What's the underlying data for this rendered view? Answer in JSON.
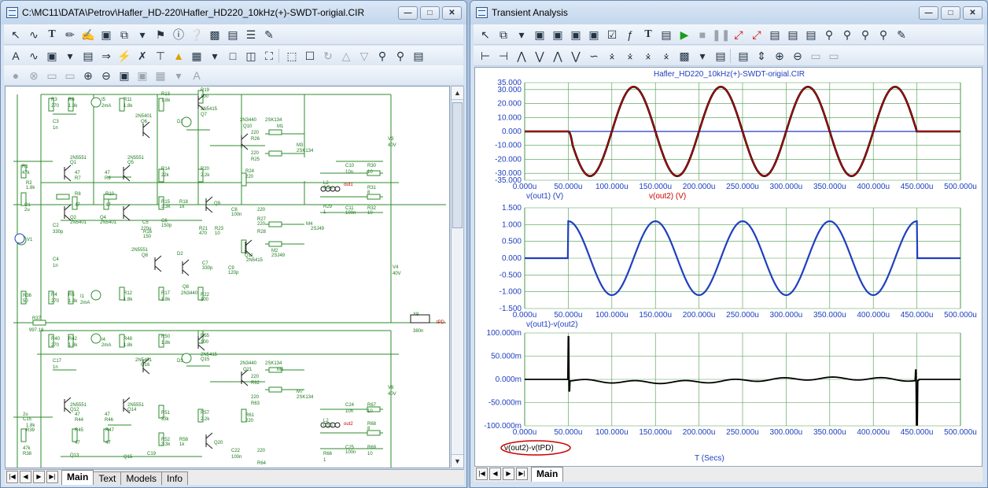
{
  "left_window": {
    "title": "C:\\MC11\\DATA\\Petrov\\Hafler_HD-220\\Hafler_HD220_10kHz(+)-SWDT-origial.CIR",
    "window_buttons": [
      "min-icon",
      "max-icon",
      "close-icon"
    ],
    "tabs": [
      "Main",
      "Text",
      "Models",
      "Info"
    ],
    "active_tab": "Main",
    "schematic_labels": [
      {
        "t": "R3",
        "c": "g"
      },
      {
        "t": "270",
        "c": "g"
      },
      {
        "t": "R6",
        "c": "g"
      },
      {
        "t": "1.8k",
        "c": "g"
      },
      {
        "t": "I5",
        "c": "g"
      },
      {
        "t": "2mA",
        "c": "g"
      },
      {
        "t": "R11",
        "c": "g"
      },
      {
        "t": "1.8k",
        "c": "g"
      },
      {
        "t": "R13",
        "c": "g"
      },
      {
        "t": "1.8k",
        "c": "g"
      },
      {
        "t": "R19",
        "c": "g"
      },
      {
        "t": "100",
        "c": "g"
      },
      {
        "t": "2N5415",
        "c": "g"
      },
      {
        "t": "Q7",
        "c": "g"
      },
      {
        "t": "C3",
        "c": "g"
      },
      {
        "t": "1n",
        "c": "g"
      },
      {
        "t": "2N5401",
        "c": "g"
      },
      {
        "t": "Q6",
        "c": "g"
      },
      {
        "t": "D1",
        "c": "g"
      },
      {
        "t": "2N3440",
        "c": "g"
      },
      {
        "t": "2SK134",
        "c": "g"
      },
      {
        "t": "Q10",
        "c": "g"
      },
      {
        "t": "M1",
        "c": "g"
      },
      {
        "t": "220",
        "c": "g"
      },
      {
        "t": "R26",
        "c": "g"
      },
      {
        "t": "M3",
        "c": "g"
      },
      {
        "t": "2SK134",
        "c": "g"
      },
      {
        "t": "220",
        "c": "g"
      },
      {
        "t": "R25",
        "c": "g"
      },
      {
        "t": "V3",
        "c": "g"
      },
      {
        "t": "40V",
        "c": "g"
      },
      {
        "t": "R1",
        "c": "g"
      },
      {
        "t": "47k",
        "c": "g"
      },
      {
        "t": "2N5551",
        "c": "g"
      },
      {
        "t": "Q1",
        "c": "g"
      },
      {
        "t": "2N5551",
        "c": "g"
      },
      {
        "t": "Q5",
        "c": "g"
      },
      {
        "t": "47",
        "c": "g"
      },
      {
        "t": "R7",
        "c": "g"
      },
      {
        "t": "47",
        "c": "g"
      },
      {
        "t": "R9",
        "c": "g"
      },
      {
        "t": "R14",
        "c": "g"
      },
      {
        "t": "22k",
        "c": "g"
      },
      {
        "t": "R20",
        "c": "g"
      },
      {
        "t": "2.2k",
        "c": "g"
      },
      {
        "t": "R24",
        "c": "g"
      },
      {
        "t": "220",
        "c": "g"
      },
      {
        "t": "C10",
        "c": "g"
      },
      {
        "t": "10n",
        "c": "g"
      },
      {
        "t": "R30",
        "c": "g"
      },
      {
        "t": "10",
        "c": "g"
      },
      {
        "t": "R2",
        "c": "g"
      },
      {
        "t": "1.8k",
        "c": "g"
      },
      {
        "t": "C1",
        "c": "g"
      },
      {
        "t": "2u",
        "c": "g"
      },
      {
        "t": "R8",
        "c": "g"
      },
      {
        "t": "47",
        "c": "g"
      },
      {
        "t": "R10",
        "c": "g"
      },
      {
        "t": "47",
        "c": "g"
      },
      {
        "t": "R15",
        "c": "g"
      },
      {
        "t": "3.3k",
        "c": "g"
      },
      {
        "t": "R18",
        "c": "g"
      },
      {
        "t": "1k",
        "c": "g"
      },
      {
        "t": "Q9",
        "c": "g"
      },
      {
        "t": "C8",
        "c": "g"
      },
      {
        "t": "100n",
        "c": "g"
      },
      {
        "t": "L2",
        "c": "g"
      },
      {
        "t": "0.5u",
        "c": "g"
      },
      {
        "t": "out1",
        "c": "r"
      },
      {
        "t": "R31",
        "c": "g"
      },
      {
        "t": "8",
        "c": "g"
      },
      {
        "t": "R29",
        "c": "g"
      },
      {
        "t": "1",
        "c": "g"
      },
      {
        "t": "C11",
        "c": "g"
      },
      {
        "t": "100n",
        "c": "g"
      },
      {
        "t": "R32",
        "c": "g"
      },
      {
        "t": "10",
        "c": "g"
      },
      {
        "t": "Q2",
        "c": "g"
      },
      {
        "t": "2N5401",
        "c": "g"
      },
      {
        "t": "Q4",
        "c": "g"
      },
      {
        "t": "2N5401",
        "c": "g"
      },
      {
        "t": "C5",
        "c": "g"
      },
      {
        "t": "220u",
        "c": "g"
      },
      {
        "t": "C6",
        "c": "g"
      },
      {
        "t": "150p",
        "c": "g"
      },
      {
        "t": "R16",
        "c": "g"
      },
      {
        "t": "150",
        "c": "g"
      },
      {
        "t": "R21",
        "c": "g"
      },
      {
        "t": "470",
        "c": "g"
      },
      {
        "t": "R23",
        "c": "g"
      },
      {
        "t": "10",
        "c": "g"
      },
      {
        "t": "220",
        "c": "g"
      },
      {
        "t": "R27",
        "c": "g"
      },
      {
        "t": "220",
        "c": "g"
      },
      {
        "t": "R28",
        "c": "g"
      },
      {
        "t": "M4",
        "c": "g"
      },
      {
        "t": "2SJ49",
        "c": "g"
      },
      {
        "t": "C2",
        "c": "g"
      },
      {
        "t": "330p",
        "c": "g"
      },
      {
        "t": "V1",
        "c": "g"
      },
      {
        "t": "2N5551",
        "c": "g"
      },
      {
        "t": "Q8",
        "c": "g"
      },
      {
        "t": "D2",
        "c": "g"
      },
      {
        "t": "Q11",
        "c": "g"
      },
      {
        "t": "2N5415",
        "c": "g"
      },
      {
        "t": "M2",
        "c": "g"
      },
      {
        "t": "2SJ49",
        "c": "g"
      },
      {
        "t": "C4",
        "c": "g"
      },
      {
        "t": "1n",
        "c": "g"
      },
      {
        "t": "C7",
        "c": "g"
      },
      {
        "t": "330p",
        "c": "g"
      },
      {
        "t": "C9",
        "c": "g"
      },
      {
        "t": "120p",
        "c": "g"
      },
      {
        "t": "Q8",
        "c": "g"
      },
      {
        "t": "2N3440",
        "c": "g"
      },
      {
        "t": "V4",
        "c": "g"
      },
      {
        "t": "40V",
        "c": "g"
      },
      {
        "t": "R36",
        "c": "g"
      },
      {
        "t": "50",
        "c": "g"
      },
      {
        "t": "R4",
        "c": "g"
      },
      {
        "t": "270",
        "c": "g"
      },
      {
        "t": "R5",
        "c": "g"
      },
      {
        "t": "1.8k",
        "c": "g"
      },
      {
        "t": "I1",
        "c": "g"
      },
      {
        "t": "2mA",
        "c": "g"
      },
      {
        "t": "R12",
        "c": "g"
      },
      {
        "t": "1.8k",
        "c": "g"
      },
      {
        "t": "R17",
        "c": "g"
      },
      {
        "t": "1.8k",
        "c": "g"
      },
      {
        "t": "R22",
        "c": "g"
      },
      {
        "t": "100",
        "c": "g"
      },
      {
        "t": "R37",
        "c": "g"
      },
      {
        "t": "997.18",
        "c": "g"
      },
      {
        "t": "X9",
        "c": "g"
      },
      {
        "t": "380n",
        "c": "g"
      },
      {
        "t": "tPD",
        "c": "r"
      },
      {
        "t": "R40",
        "c": "g"
      },
      {
        "t": "270",
        "c": "g"
      },
      {
        "t": "R42",
        "c": "g"
      },
      {
        "t": "1.8k",
        "c": "g"
      },
      {
        "t": "I4",
        "c": "g"
      },
      {
        "t": "2mA",
        "c": "g"
      },
      {
        "t": "R48",
        "c": "g"
      },
      {
        "t": "1.8k",
        "c": "g"
      },
      {
        "t": "R50",
        "c": "g"
      },
      {
        "t": "1.8k",
        "c": "g"
      },
      {
        "t": "R55",
        "c": "g"
      },
      {
        "t": "100",
        "c": "g"
      },
      {
        "t": "2N5415",
        "c": "g"
      },
      {
        "t": "Q15",
        "c": "g"
      },
      {
        "t": "C17",
        "c": "g"
      },
      {
        "t": "1n",
        "c": "g"
      },
      {
        "t": "2N5401",
        "c": "g"
      },
      {
        "t": "Q16",
        "c": "g"
      },
      {
        "t": "D3",
        "c": "g"
      },
      {
        "t": "2N3440",
        "c": "g"
      },
      {
        "t": "2SK134",
        "c": "g"
      },
      {
        "t": "Q21",
        "c": "g"
      },
      {
        "t": "M5",
        "c": "g"
      },
      {
        "t": "220",
        "c": "g"
      },
      {
        "t": "R62",
        "c": "g"
      },
      {
        "t": "M7",
        "c": "g"
      },
      {
        "t": "2SK134",
        "c": "g"
      },
      {
        "t": "220",
        "c": "g"
      },
      {
        "t": "R63",
        "c": "g"
      },
      {
        "t": "V9",
        "c": "g"
      },
      {
        "t": "40V",
        "c": "g"
      },
      {
        "t": "2N5551",
        "c": "g"
      },
      {
        "t": "Q12",
        "c": "g"
      },
      {
        "t": "2N5551",
        "c": "g"
      },
      {
        "t": "Q14",
        "c": "g"
      },
      {
        "t": "47",
        "c": "g"
      },
      {
        "t": "R44",
        "c": "g"
      },
      {
        "t": "47",
        "c": "g"
      },
      {
        "t": "R46",
        "c": "g"
      },
      {
        "t": "R51",
        "c": "g"
      },
      {
        "t": "33k",
        "c": "g"
      },
      {
        "t": "R57",
        "c": "g"
      },
      {
        "t": "2.2k",
        "c": "g"
      },
      {
        "t": "R61",
        "c": "g"
      },
      {
        "t": "220",
        "c": "g"
      },
      {
        "t": "C24",
        "c": "g"
      },
      {
        "t": "10n",
        "c": "g"
      },
      {
        "t": "R67",
        "c": "g"
      },
      {
        "t": "10",
        "c": "g"
      },
      {
        "t": "2u",
        "c": "g"
      },
      {
        "t": "C15",
        "c": "g"
      },
      {
        "t": "1.8k",
        "c": "g"
      },
      {
        "t": "R39",
        "c": "g"
      },
      {
        "t": "R45",
        "c": "g"
      },
      {
        "t": "47",
        "c": "g"
      },
      {
        "t": "R47",
        "c": "g"
      },
      {
        "t": "47",
        "c": "g"
      },
      {
        "t": "R52",
        "c": "g"
      },
      {
        "t": "3.3k",
        "c": "g"
      },
      {
        "t": "R58",
        "c": "g"
      },
      {
        "t": "1k",
        "c": "g"
      },
      {
        "t": "Q20",
        "c": "g"
      },
      {
        "t": "L2",
        "c": "g"
      },
      {
        "t": "0.5u",
        "c": "g"
      },
      {
        "t": "out2",
        "c": "r"
      },
      {
        "t": "R68",
        "c": "g"
      },
      {
        "t": "8",
        "c": "g"
      },
      {
        "t": "47k",
        "c": "g"
      },
      {
        "t": "R38",
        "c": "g"
      },
      {
        "t": "Q13",
        "c": "g"
      },
      {
        "t": "Q15",
        "c": "g"
      },
      {
        "t": "C19",
        "c": "g"
      },
      {
        "t": "C22",
        "c": "g"
      },
      {
        "t": "100n",
        "c": "g"
      },
      {
        "t": "220",
        "c": "g"
      },
      {
        "t": "R64",
        "c": "g"
      },
      {
        "t": "R66",
        "c": "g"
      },
      {
        "t": "1",
        "c": "g"
      },
      {
        "t": "C25",
        "c": "g"
      },
      {
        "t": "100n",
        "c": "g"
      },
      {
        "t": "R69",
        "c": "g"
      },
      {
        "t": "10",
        "c": "g"
      }
    ]
  },
  "right_window": {
    "title": "Transient Analysis",
    "window_buttons": [
      "min-icon",
      "max-icon",
      "close-icon"
    ],
    "tabs": [
      "Main"
    ],
    "chart_title": "Hafler_HD220_10kHz(+)-SWDT-origial.CIR",
    "x_axis_label": "T (Secs)",
    "colors": {
      "blue": "#1f3fbf",
      "red": "#cc0000",
      "black": "#000000",
      "grid": "#4a9a4a"
    }
  },
  "chart_data": [
    {
      "type": "line",
      "ylim": [
        -35,
        35
      ],
      "y_ticks": [
        "35.000",
        "30.000",
        "20.000",
        "10.000",
        "0.000",
        "-10.000",
        "-20.000",
        "-30.000",
        "-35.000"
      ],
      "x_ticks": [
        "0.000u",
        "50.000u",
        "100.000u",
        "150.000u",
        "200.000u",
        "250.000u",
        "300.000u",
        "350.000u",
        "400.000u",
        "450.000u",
        "500.000u"
      ],
      "xlim": [
        0,
        500
      ],
      "legend": [
        {
          "label": "v(out1) (V)",
          "color": "#1f3fbf"
        },
        {
          "label": "v(out2) (V)",
          "color": "#cc0000"
        }
      ],
      "series": [
        {
          "name": "v(out1) (V)",
          "description": "flat 0"
        },
        {
          "name": "v(out2) (V)",
          "amplitude": 32,
          "period_us": 100,
          "start_us": 50,
          "end_us": 450
        }
      ]
    },
    {
      "type": "line",
      "ylim": [
        -1.5,
        1.5
      ],
      "y_ticks": [
        "1.500",
        "1.000",
        "0.500",
        "0.000",
        "-0.500",
        "-1.000",
        "-1.500"
      ],
      "x_ticks": [
        "0.000u",
        "50.000u",
        "100.000u",
        "150.000u",
        "200.000u",
        "250.000u",
        "300.000u",
        "350.000u",
        "400.000u",
        "450.000u",
        "500.000u"
      ],
      "xlim": [
        0,
        500
      ],
      "legend": [
        {
          "label": "v(out1)-v(out2)",
          "color": "#1f3fbf"
        }
      ],
      "series": [
        {
          "name": "v(out1)-v(out2)",
          "amplitude": 1.1,
          "period_us": 100,
          "start_us": 50,
          "end_us": 450
        }
      ]
    },
    {
      "type": "line",
      "ylim": [
        -100,
        100
      ],
      "y_ticks": [
        "100.000m",
        "50.000m",
        "0.000m",
        "-50.000m",
        "-100.000m"
      ],
      "x_ticks": [
        "0.000u",
        "50.000u",
        "100.000u",
        "150.000u",
        "200.000u",
        "250.000u",
        "300.000u",
        "350.000u",
        "400.000u",
        "450.000u",
        "500.000u"
      ],
      "xlim": [
        0,
        500
      ],
      "legend": [
        {
          "label": "v(out2)-v(tPD)",
          "color": "#000000",
          "highlight": "#cc0000"
        }
      ],
      "series": [
        {
          "name": "v(out2)-v(tPD)",
          "spike_at_us": [
            50,
            450
          ],
          "spike_peak_m": 92,
          "spike_min_m": -98
        }
      ]
    }
  ]
}
